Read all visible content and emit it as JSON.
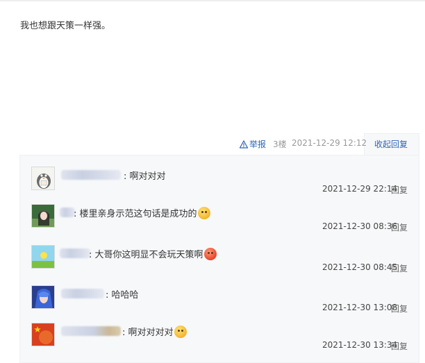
{
  "post": {
    "text": "我也想跟天策一样强。",
    "report_label": "举报",
    "floor": "3楼",
    "time": "2021-12-29 12:12",
    "collapse_label": "收起回复"
  },
  "replies": [
    {
      "content": ": 啊对对对",
      "time": "2021-12-29 22:14",
      "reply_label": "回复",
      "emoji": ""
    },
    {
      "content": ": 楼里亲身示范这句话是成功的",
      "time": "2021-12-30 08:36",
      "reply_label": "回复",
      "emoji": "smile-emoji"
    },
    {
      "content": ": 大哥你这明显不会玩天策啊",
      "time": "2021-12-30 08:45",
      "reply_label": "回复",
      "emoji": "angry-emoji"
    },
    {
      "content": ": 哈哈哈",
      "time": "2021-12-30 13:08",
      "reply_label": "回复",
      "emoji": ""
    },
    {
      "content": ": 啊对对对对",
      "time": "2021-12-30 13:34",
      "reply_label": "回复",
      "emoji": "smile-emoji"
    }
  ],
  "colors": {
    "link": "#2d64b3",
    "muted": "#999999",
    "reply_bg": "#f7f8fa"
  }
}
